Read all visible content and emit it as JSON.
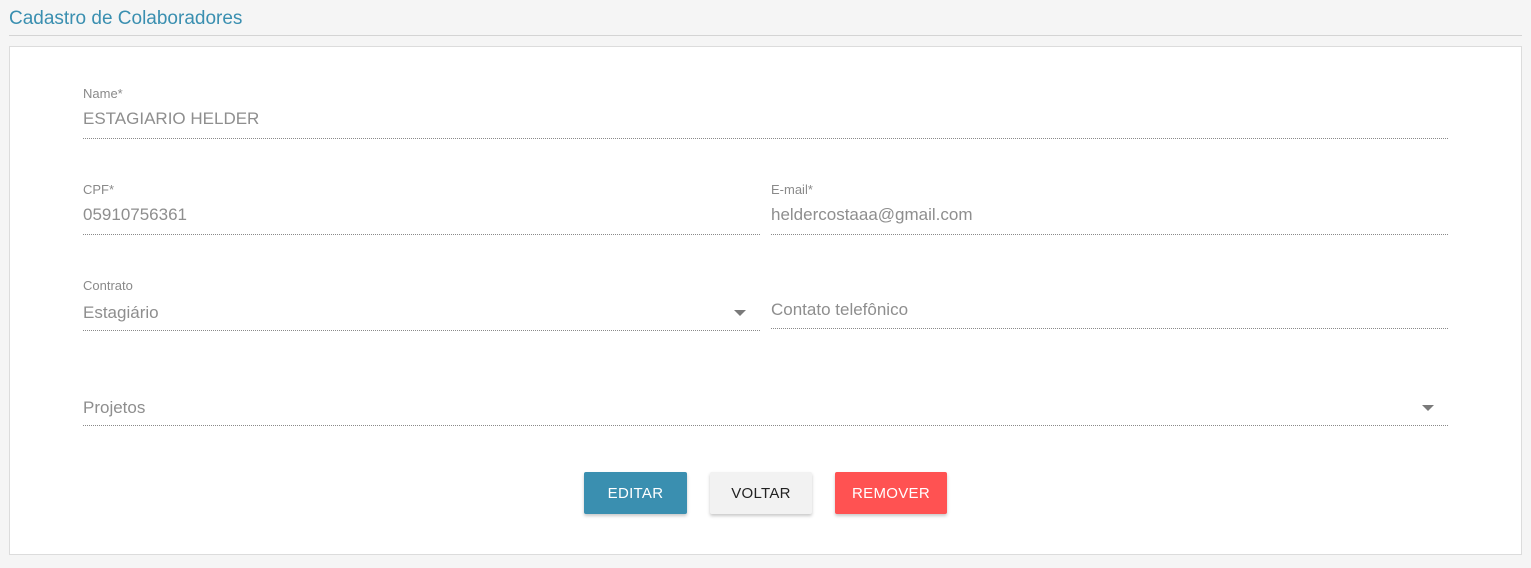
{
  "page": {
    "title": "Cadastro de Colaboradores"
  },
  "form": {
    "name": {
      "label": "Name*",
      "value": "ESTAGIARIO HELDER"
    },
    "cpf": {
      "label": "CPF*",
      "value": "05910756361"
    },
    "email": {
      "label": "E-mail*",
      "value": "heldercostaaa@gmail.com"
    },
    "contrato": {
      "label": "Contrato",
      "value": "Estagiário",
      "icon": "chevron-down-icon"
    },
    "contato": {
      "placeholder": "Contato telefônico"
    },
    "projetos": {
      "placeholder": "Projetos",
      "icon": "chevron-down-icon"
    }
  },
  "actions": {
    "edit_label": "EDITAR",
    "back_label": "VOLTAR",
    "remove_label": "REMOVER"
  },
  "colors": {
    "accent": "#3a8fb0",
    "edit_button": "#3a8fb0",
    "remove_button": "#ff5252"
  }
}
